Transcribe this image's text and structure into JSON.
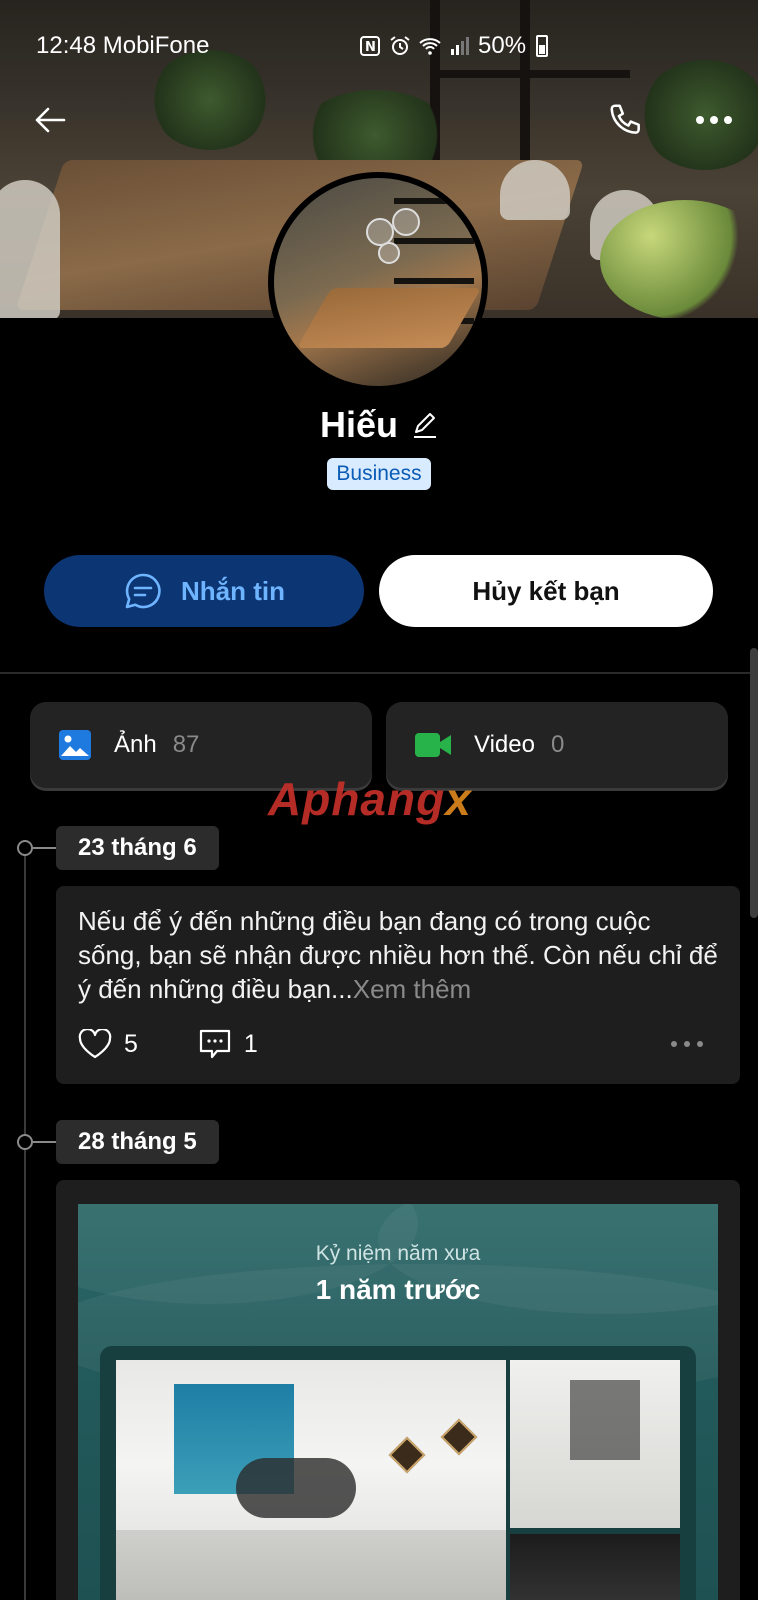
{
  "status_bar": {
    "time_carrier": "12:48 MobiFone",
    "battery": "50%",
    "icons": [
      "nfc-icon",
      "alarm-icon",
      "wifi-icon",
      "signal-icon",
      "battery-icon"
    ]
  },
  "header": {
    "back_icon": "back-arrow-icon",
    "call_icon": "phone-icon",
    "more_icon": "more-horizontal-icon"
  },
  "profile": {
    "name": "Hiếu",
    "edit_icon": "pencil-icon",
    "badge": "Business"
  },
  "actions": {
    "message_label": "Nhắn tin",
    "unfriend_label": "Hủy kết bạn"
  },
  "media": {
    "photos_label": "Ảnh",
    "photos_count": "87",
    "videos_label": "Video",
    "videos_count": "0"
  },
  "watermark": {
    "main": "Aphang",
    "suffix": "x"
  },
  "timeline": {
    "entries": [
      {
        "date": "23 tháng 6",
        "text": "Nếu để ý đến những điều bạn đang có trong cuộc sống, bạn sẽ nhận được nhiều hơn thế. Còn nếu chỉ để ý đến những điều bạn...",
        "see_more": "Xem thêm",
        "likes": "5",
        "comments": "1"
      },
      {
        "date": "28 tháng 5",
        "memory_subtitle": "Kỷ niệm năm xưa",
        "memory_title": "1 năm trước"
      }
    ]
  },
  "colors": {
    "message_button_bg": "#0b3573",
    "message_button_text": "#6fb4ff",
    "badge_bg": "#d9ecff",
    "badge_text": "#0a5bb5",
    "photo_icon": "#1f7ae0",
    "video_icon": "#27b24a",
    "memory_bg": "#2f6a6a"
  }
}
